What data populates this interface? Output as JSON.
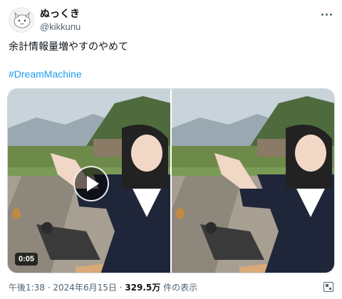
{
  "post": {
    "display_name": "ぬっくき",
    "handle": "@kikkunu",
    "text": "余計情報量増やすのやめて",
    "hashtag": "#DreamMachine"
  },
  "media": {
    "duration": "0:05",
    "video_count": 2
  },
  "meta": {
    "time": "午後1:38",
    "sep1": " · ",
    "date": "2024年6月15日",
    "sep2": " · ",
    "views": "329.5万",
    "views_suffix": " 件の表示"
  },
  "icons": {
    "more": "more-icon",
    "play": "play-icon",
    "qr": "qr-icon"
  },
  "colors": {
    "link": "#1d9bf0",
    "secondary": "#536471",
    "text": "#0f1419"
  }
}
